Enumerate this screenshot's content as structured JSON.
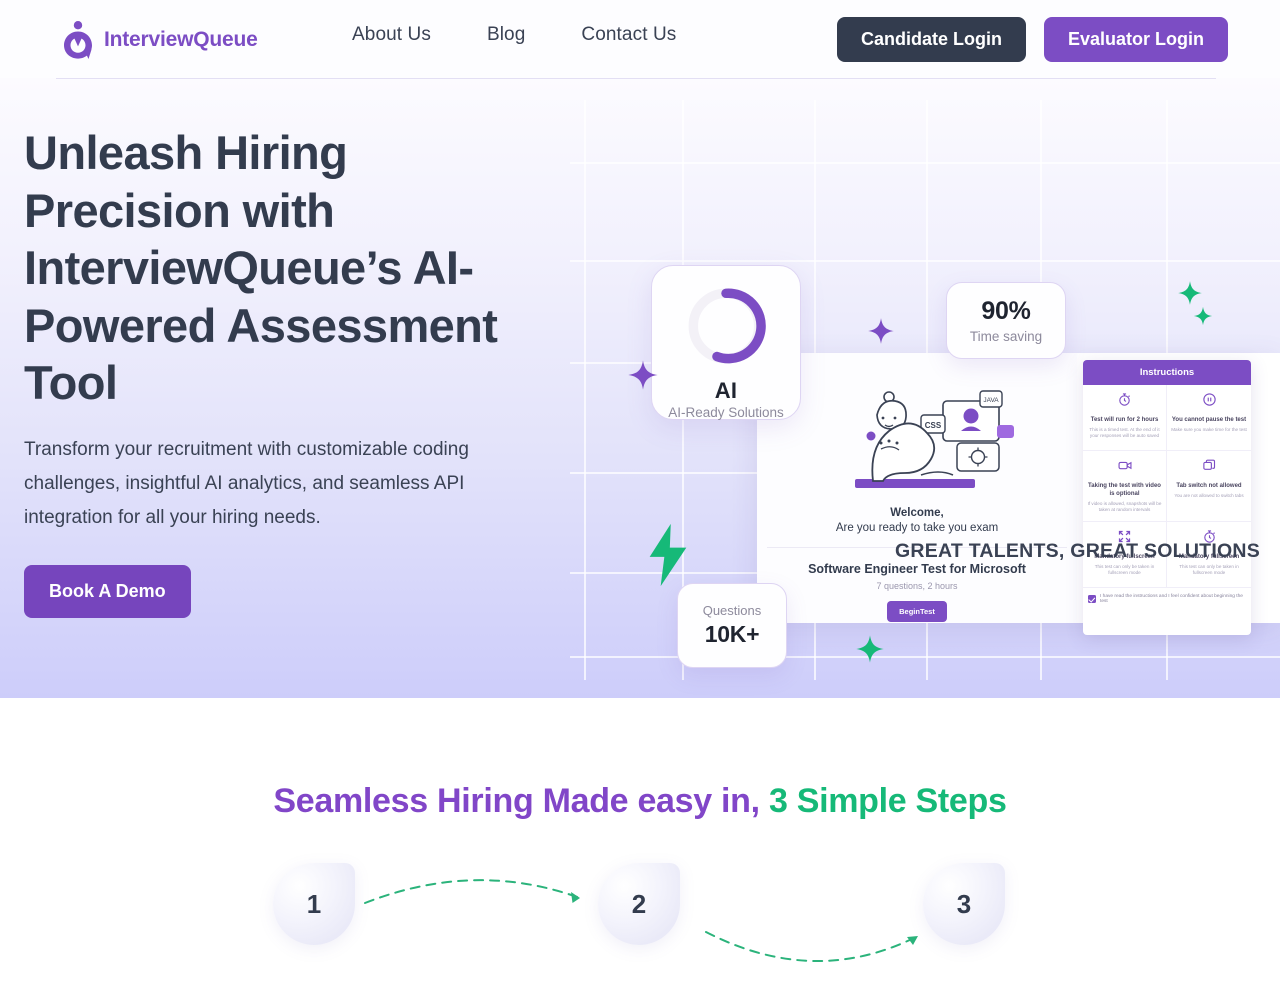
{
  "header": {
    "brand": "InterviewQueue",
    "brand_icon": "interviewqueue-logo-icon",
    "nav": [
      {
        "label": "About Us"
      },
      {
        "label": "Blog"
      },
      {
        "label": "Contact Us"
      }
    ],
    "candidate_login": "Candidate Login",
    "evaluator_login": "Evaluator Login",
    "colors": {
      "dark": "#333c4e",
      "purple": "#7c4dc4"
    }
  },
  "hero": {
    "title": "Unleash Hiring Precision with InterviewQueue’s AI-Powered Assessment Tool",
    "subtitle": "Transform your recruitment with customizable coding challenges, insightful AI analytics, and seamless API integration for all your hiring needs.",
    "cta": "Book A Demo",
    "tagline": "GREAT TALENTS, GREAT SOLUTIONS",
    "background_gradient": [
      "#fcfbff",
      "#cdcdfa"
    ]
  },
  "hero_art": {
    "ai_card": {
      "label": "AI",
      "sublabel": "AI-Ready Solutions",
      "ring_color": "#7c4dc4",
      "ring_track": "#f2f0f6",
      "ring_percent": 62
    },
    "stat_time": {
      "value": "90%",
      "label": "Time saving"
    },
    "stat_questions": {
      "label": "Questions",
      "value": "10K+"
    },
    "screen": {
      "welcome_line1": "Welcome,",
      "welcome_line2": "Are you ready to take you exam",
      "test_title": "Software Engineer Test for Microsoft",
      "test_meta": "7 questions, 2 hours",
      "begin_button": "BeginTest",
      "badge_css": "CSS",
      "badge_java": "JAVA"
    },
    "instructions": {
      "header": "Instructions",
      "items": [
        {
          "icon": "stopwatch-icon",
          "title": "Test will run for 2 hours",
          "desc": "This is a timed test. At the end of it your responses will be auto saved"
        },
        {
          "icon": "pause-icon",
          "title": "You cannot pause the test",
          "desc": "Make sure you make time for the test"
        },
        {
          "icon": "video-camera-icon",
          "title": "Taking the test with video is optional",
          "desc": "If video is allowed, snapshots will be taken at random intervals"
        },
        {
          "icon": "tab-switch-icon",
          "title": "Tab switch not allowed",
          "desc": "You are not allowed to switch tabs"
        },
        {
          "icon": "fullscreen-expand-icon",
          "title": "Mandatory fullscreen",
          "desc": "This test can only be taken in fullscreen mode"
        },
        {
          "icon": "stopwatch-icon",
          "title": "Mandatory fullscreen",
          "desc": "This test can only be taken in fullscreen mode"
        }
      ],
      "consent": "I have read the instructions and I feel confident about beginning the test"
    },
    "decorations": {
      "sparkle_purple": "#7c4dc4",
      "sparkle_green": "#16b978",
      "bolt_green": "#16b978"
    }
  },
  "steps": {
    "heading_purple": "Seamless Hiring Made easy in,",
    "heading_green": " 3 Simple Steps",
    "items": [
      {
        "number": "1"
      },
      {
        "number": "2"
      },
      {
        "number": "3"
      }
    ],
    "arrow_color": "#2bb37b"
  }
}
